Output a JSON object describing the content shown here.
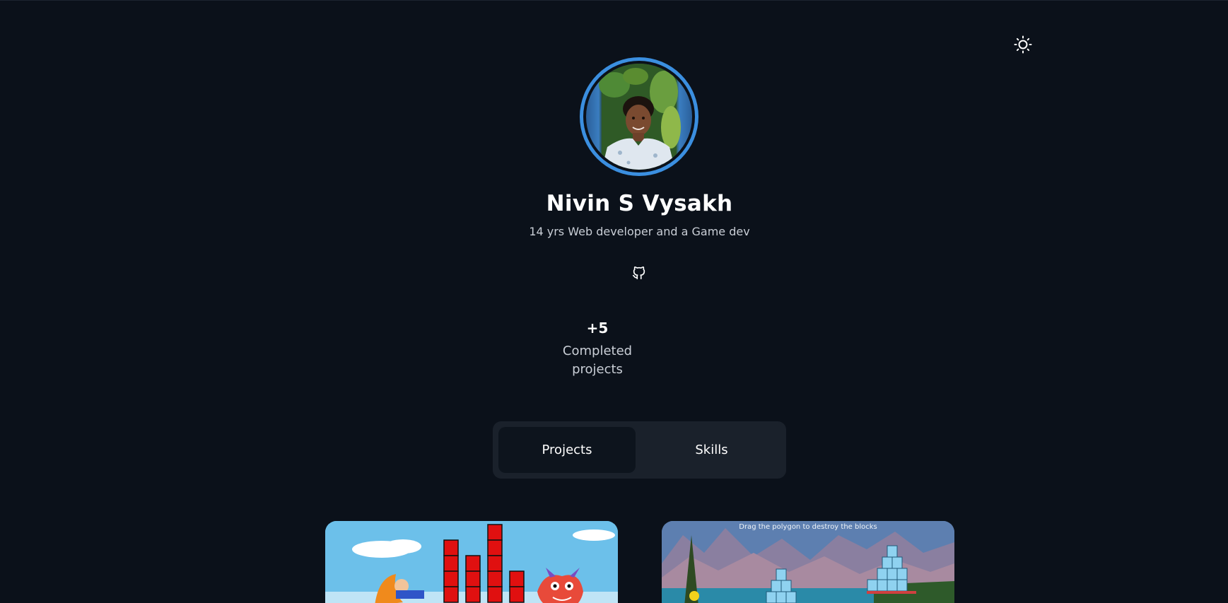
{
  "theme_toggle": {
    "icon": "sun-icon"
  },
  "profile": {
    "name": "Nivin S Vysakh",
    "tagline": "14 yrs Web developer and a Game dev",
    "avatar_alt": "profile photo",
    "social": {
      "github_icon": "github-icon"
    }
  },
  "stats": [
    {
      "value": "+5",
      "label": "Completed projects"
    }
  ],
  "tabs": [
    {
      "label": "Projects",
      "active": true
    },
    {
      "label": "Skills",
      "active": false
    }
  ],
  "projects": [
    {
      "thumbnail_caption": ""
    },
    {
      "thumbnail_caption": "Drag the polygon to destroy the blocks"
    }
  ],
  "colors": {
    "background": "#0b111a",
    "accent": "#3b8fe0",
    "tab_container": "#1a212b",
    "tab_active": "#0d141d",
    "muted_text": "#c9ced6"
  }
}
